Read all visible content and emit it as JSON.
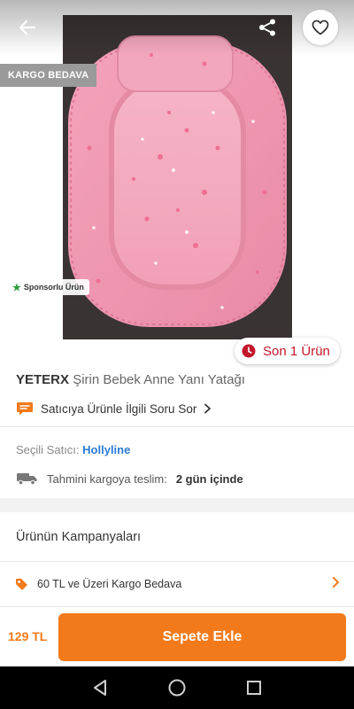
{
  "hero": {
    "badges": {
      "cargo": "KARGO BEDAVA",
      "sponsored": "Sponsorlu Ürün",
      "stock": "Son 1 Ürün"
    },
    "icons": {
      "back": "arrow-left-icon",
      "share": "share-icon",
      "favorite": "heart-outline-icon",
      "sponsored": "star-icon",
      "stock": "clock-icon"
    }
  },
  "product": {
    "brand": "YETERX",
    "name": "Şirin Bebek Anne Yanı Yatağı",
    "ask_seller": "Satıcıya Ürünle İlgili Soru Sor"
  },
  "seller": {
    "label": "Seçili Satıcı:",
    "name": "Hollyline"
  },
  "delivery": {
    "label": "Tahmini kargoya teslim:",
    "when": "2 gün içinde"
  },
  "campaigns": {
    "title": "Ürünün Kampanyaları",
    "items": [
      {
        "label": "60 TL ve Üzeri Kargo Bedava",
        "icon": "tag-icon"
      }
    ]
  },
  "action_bar": {
    "price": "129 TL",
    "add_to_cart": "Sepete Ekle"
  },
  "colors": {
    "accent": "#f27a1a",
    "stock_red": "#c2172b",
    "seller_link": "#2a7bd4",
    "sponsor_green": "#2e9e3e"
  },
  "android_nav": {
    "items": [
      "back-triangle-icon",
      "home-circle-icon",
      "recents-square-icon"
    ]
  }
}
